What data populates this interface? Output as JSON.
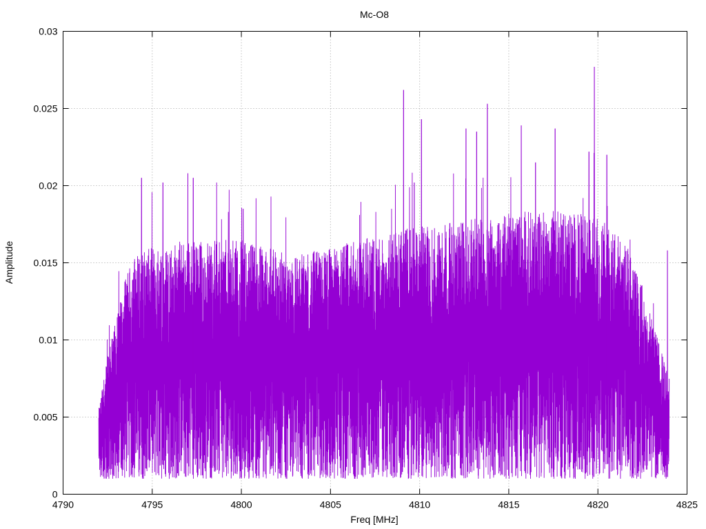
{
  "chart_data": {
    "type": "line",
    "title": "Mc-O8",
    "xlabel": "Freq [MHz]",
    "ylabel": "Amplitude",
    "xlim": [
      4790,
      4825
    ],
    "ylim": [
      0,
      0.03
    ],
    "xticks": [
      "4790",
      "4795",
      "4800",
      "4805",
      "4810",
      "4815",
      "4820",
      "4825"
    ],
    "yticks": [
      "0",
      "0.005",
      "0.01",
      "0.015",
      "0.02",
      "0.025",
      "0.03"
    ],
    "grid": true,
    "line_color": "#9400d3",
    "series": [
      {
        "x_range": [
          4792.0,
          4824.0
        ],
        "envelope": [
          {
            "x": 4792.0,
            "lo": 0.001,
            "hi": 0.0055
          },
          {
            "x": 4792.5,
            "lo": 0.001,
            "hi": 0.009
          },
          {
            "x": 4793.0,
            "lo": 0.001,
            "hi": 0.0115
          },
          {
            "x": 4793.5,
            "lo": 0.001,
            "hi": 0.014
          },
          {
            "x": 4794.0,
            "lo": 0.001,
            "hi": 0.0155
          },
          {
            "x": 4795.0,
            "lo": 0.001,
            "hi": 0.016
          },
          {
            "x": 4797.0,
            "lo": 0.001,
            "hi": 0.0165
          },
          {
            "x": 4800.0,
            "lo": 0.001,
            "hi": 0.0165
          },
          {
            "x": 4803.0,
            "lo": 0.001,
            "hi": 0.0155
          },
          {
            "x": 4805.0,
            "lo": 0.001,
            "hi": 0.016
          },
          {
            "x": 4808.0,
            "lo": 0.001,
            "hi": 0.017
          },
          {
            "x": 4811.0,
            "lo": 0.001,
            "hi": 0.0175
          },
          {
            "x": 4814.0,
            "lo": 0.001,
            "hi": 0.018
          },
          {
            "x": 4817.0,
            "lo": 0.001,
            "hi": 0.0185
          },
          {
            "x": 4820.0,
            "lo": 0.001,
            "hi": 0.018
          },
          {
            "x": 4821.5,
            "lo": 0.001,
            "hi": 0.0165
          },
          {
            "x": 4822.5,
            "lo": 0.001,
            "hi": 0.0135
          },
          {
            "x": 4823.5,
            "lo": 0.001,
            "hi": 0.0095
          },
          {
            "x": 4824.0,
            "lo": 0.001,
            "hi": 0.0075
          }
        ],
        "peaks": [
          {
            "x": 4794.4,
            "y": 0.0205
          },
          {
            "x": 4795.6,
            "y": 0.0202
          },
          {
            "x": 4797.0,
            "y": 0.0208
          },
          {
            "x": 4797.3,
            "y": 0.0205
          },
          {
            "x": 4800.1,
            "y": 0.0185
          },
          {
            "x": 4809.1,
            "y": 0.0262
          },
          {
            "x": 4809.7,
            "y": 0.0202
          },
          {
            "x": 4810.1,
            "y": 0.0243
          },
          {
            "x": 4812.6,
            "y": 0.0237
          },
          {
            "x": 4813.2,
            "y": 0.0235
          },
          {
            "x": 4813.8,
            "y": 0.0253
          },
          {
            "x": 4815.7,
            "y": 0.0239
          },
          {
            "x": 4816.5,
            "y": 0.0215
          },
          {
            "x": 4817.6,
            "y": 0.0237
          },
          {
            "x": 4819.5,
            "y": 0.0222
          },
          {
            "x": 4819.8,
            "y": 0.0277
          },
          {
            "x": 4820.5,
            "y": 0.022
          },
          {
            "x": 4823.9,
            "y": 0.0158
          }
        ]
      }
    ]
  }
}
